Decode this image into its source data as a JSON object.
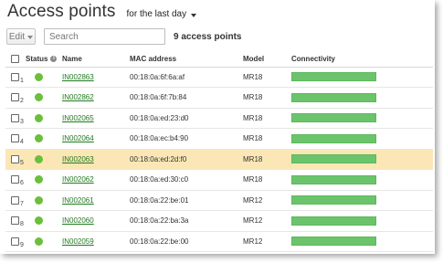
{
  "header": {
    "title": "Access points",
    "timeframe": "for the last day"
  },
  "toolbar": {
    "edit_label": "Edit",
    "search_placeholder": "Search",
    "count_label": "9 access points"
  },
  "table": {
    "columns": {
      "status": "Status",
      "name": "Name",
      "mac": "MAC address",
      "model": "Model",
      "connectivity": "Connectivity"
    },
    "rows": [
      {
        "num": "1",
        "name": "IN002863",
        "mac": "00:18:0a:6f:6a:af",
        "model": "MR18",
        "status": "online",
        "connectivity": 1.0,
        "selected": false
      },
      {
        "num": "2",
        "name": "IN002862",
        "mac": "00:18:0a:6f:7b:84",
        "model": "MR18",
        "status": "online",
        "connectivity": 1.0,
        "selected": false
      },
      {
        "num": "3",
        "name": "IN002065",
        "mac": "00:18:0a:ed:23:d0",
        "model": "MR18",
        "status": "online",
        "connectivity": 1.0,
        "selected": false
      },
      {
        "num": "4",
        "name": "IN002064",
        "mac": "00:18:0a:ec:b4:90",
        "model": "MR18",
        "status": "online",
        "connectivity": 1.0,
        "selected": false
      },
      {
        "num": "5",
        "name": "IN002063",
        "mac": "00:18:0a:ed:2d:f0",
        "model": "MR18",
        "status": "online",
        "connectivity": 1.0,
        "selected": true
      },
      {
        "num": "6",
        "name": "IN002062",
        "mac": "00:18:0a:ed:30:c0",
        "model": "MR18",
        "status": "online",
        "connectivity": 1.0,
        "selected": false
      },
      {
        "num": "7",
        "name": "IN002061",
        "mac": "00:18:0a:22:be:01",
        "model": "MR12",
        "status": "online",
        "connectivity": 1.0,
        "selected": false
      },
      {
        "num": "8",
        "name": "IN002060",
        "mac": "00:18:0a:22:ba:3a",
        "model": "MR12",
        "status": "online",
        "connectivity": 1.0,
        "selected": false
      },
      {
        "num": "9",
        "name": "IN002059",
        "mac": "00:18:0a:22:be:00",
        "model": "MR12",
        "status": "online",
        "connectivity": 1.0,
        "selected": false
      }
    ]
  },
  "colors": {
    "status_online": "#6bbf3b",
    "connectivity_good": "#6bc46b",
    "selected_row": "#fbe7b5",
    "link": "#217a21"
  }
}
